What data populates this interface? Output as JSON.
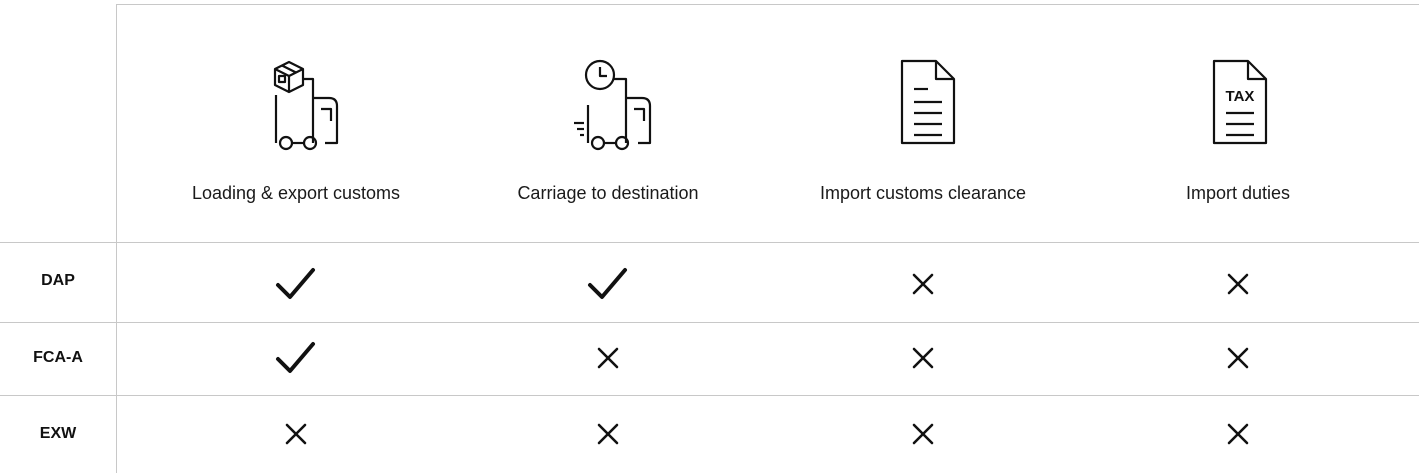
{
  "columns": [
    {
      "label": "Loading & export customs",
      "icon": "truck-with-package-icon"
    },
    {
      "label": "Carriage to destination",
      "icon": "truck-with-clock-icon"
    },
    {
      "label": "Import customs clearance",
      "icon": "document-icon"
    },
    {
      "label": "Import duties",
      "icon": "tax-document-icon",
      "icon_text": "TAX"
    }
  ],
  "rows": [
    {
      "label": "DAP",
      "cells": [
        "check",
        "check",
        "cross",
        "cross"
      ]
    },
    {
      "label": "FCA-A",
      "cells": [
        "check",
        "cross",
        "cross",
        "cross"
      ]
    },
    {
      "label": "EXW",
      "cells": [
        "cross",
        "cross",
        "cross",
        "cross"
      ]
    }
  ],
  "colors": {
    "grid": "#c8c8c8",
    "ink": "#111111"
  }
}
